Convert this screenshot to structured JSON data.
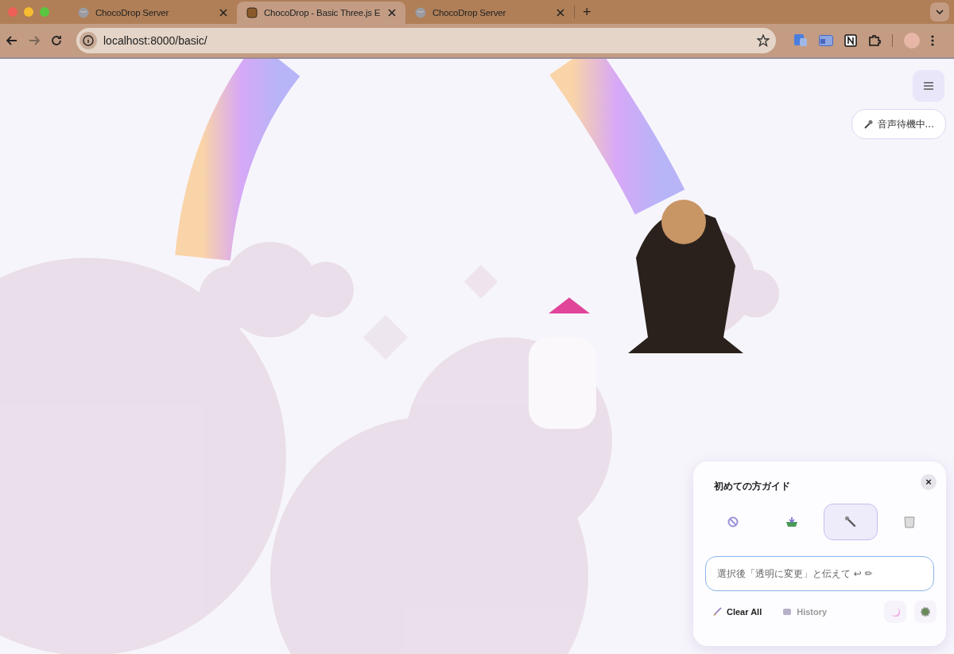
{
  "browser": {
    "tabs": [
      {
        "title": "ChocoDrop Server",
        "selected": false
      },
      {
        "title": "ChocoDrop - Basic Three.js E",
        "selected": true
      },
      {
        "title": "ChocoDrop Server",
        "selected": false
      }
    ],
    "new_tab": "+",
    "address": "localhost:8000/basic/"
  },
  "voice_status": "音声待機中...",
  "guide": {
    "title": "初めての方ガイド",
    "close": "×",
    "modes": [
      {
        "kind": "none",
        "selected": false
      },
      {
        "kind": "import",
        "selected": false
      },
      {
        "kind": "modify",
        "selected": true
      },
      {
        "kind": "delete",
        "selected": false
      }
    ],
    "input": {
      "placeholder": "選択後「透明に変更」と伝えて ↩ ✏"
    },
    "actions": [
      {
        "kind": "clear",
        "label": "Clear All",
        "disabled": false
      },
      {
        "kind": "history",
        "label": "History",
        "disabled": true
      }
    ]
  }
}
